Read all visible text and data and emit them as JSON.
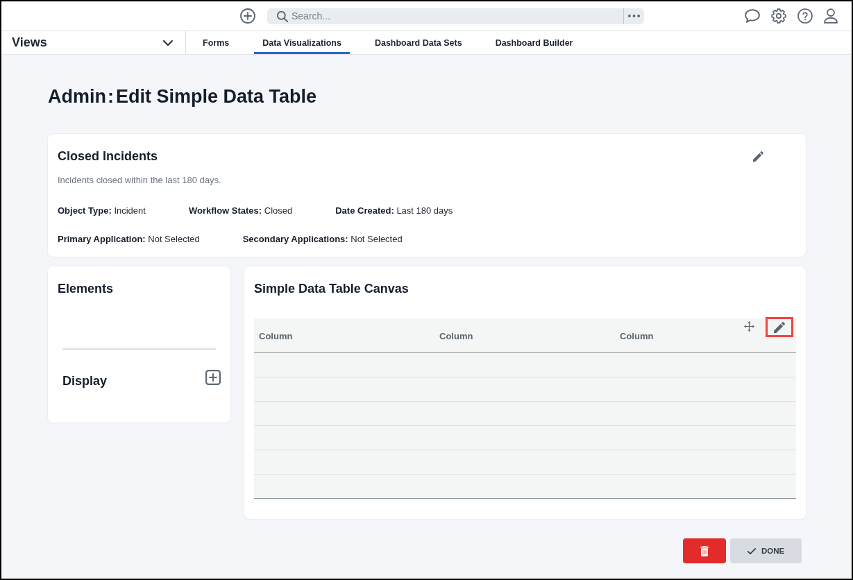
{
  "top_bar": {
    "search": {
      "placeholder": "Search..."
    }
  },
  "nav": {
    "views_label": "Views",
    "tabs": [
      {
        "label": "Forms",
        "selected": false
      },
      {
        "label": "Data Visualizations",
        "selected": true
      },
      {
        "label": "Dashboard Data Sets",
        "selected": false
      },
      {
        "label": "Dashboard Builder",
        "selected": false
      }
    ]
  },
  "page_title": {
    "parent": "Admin",
    "separator": ":",
    "current": "Edit Simple Data Table"
  },
  "summary": {
    "title": "Closed Incidents",
    "description": "Incidents closed within the last 180 days.",
    "detail_rows": [
      [
        {
          "label": "Object Type:",
          "value": "Incident"
        },
        {
          "label": "Workflow States:",
          "value": "Closed"
        },
        {
          "label": "Date Created:",
          "value": "Last 180 days"
        }
      ],
      [
        {
          "label": "Primary Application:",
          "value": "Not Selected"
        },
        {
          "label": "Secondary Applications:",
          "value": "Not Selected"
        }
      ]
    ]
  },
  "elements_panel": {
    "title": "Elements",
    "sections": [
      {
        "title": "Display"
      }
    ]
  },
  "canvas": {
    "title": "Simple Data Table Canvas",
    "columns": [
      "Column",
      "Column",
      "Column"
    ],
    "edit_button": {
      "highlighted": true
    }
  },
  "actions": [
    {
      "kind": "delete"
    },
    {
      "kind": "done",
      "label": "DONE"
    }
  ]
}
